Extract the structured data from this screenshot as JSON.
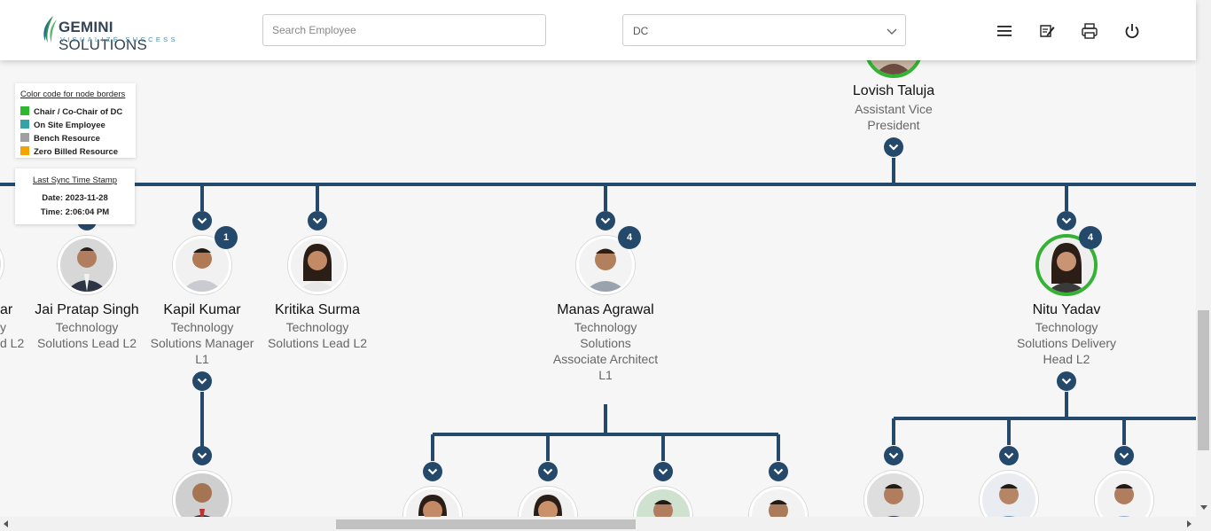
{
  "header": {
    "logo_name_bold": "GEMINI",
    "logo_name_rest": " SOLUTIONS",
    "logo_tagline": "VISUALIZE SUCCESS",
    "search_placeholder": "Search Employee",
    "department_selected": "DC",
    "icons": [
      "menu-icon",
      "notes-edit-icon",
      "print-icon",
      "power-icon"
    ]
  },
  "legend": {
    "title": "Color code for node borders",
    "items": [
      {
        "label": "Chair / Co-Chair of DC",
        "color": "#2eb82e"
      },
      {
        "label": "On Site Employee",
        "color": "#35a2a8"
      },
      {
        "label": "Bench Resource",
        "color": "#a0a0a0"
      },
      {
        "label": "Zero Billed Resource",
        "color": "#f5a300"
      }
    ]
  },
  "sync": {
    "title": "Last Sync Time Stamp",
    "date": "Date: 2023-11-28",
    "time": "Time: 2:06:04 PM"
  },
  "top_node": {
    "name": "Lovish Taluja",
    "title_line1": "Assistant Vice",
    "title_line2": "President"
  },
  "partial_node": {
    "name_fragment": "ar",
    "line1_fragment": "y",
    "line2_fragment": "d L2"
  },
  "nodes": [
    {
      "name": "Jai Pratap Singh",
      "lines": [
        "Technology",
        "Solutions Lead L2"
      ],
      "badge": ""
    },
    {
      "name": "Kapil Kumar",
      "lines": [
        "Technology",
        "Solutions Manager",
        "L1"
      ],
      "badge": "1"
    },
    {
      "name": "Kritika Surma",
      "lines": [
        "Technology",
        "Solutions Lead L2"
      ],
      "badge": ""
    },
    {
      "name": "Manas Agrawal",
      "lines": [
        "Technology",
        "Solutions",
        "Associate Architect",
        "L1"
      ],
      "badge": "4"
    },
    {
      "name": "Nitu Yadav",
      "lines": [
        "Technology",
        "Solutions Delivery",
        "Head L2"
      ],
      "badge": "4"
    }
  ],
  "colors": {
    "line": "#24496b",
    "badge": "#24496b",
    "chair_border": "#33b233"
  }
}
